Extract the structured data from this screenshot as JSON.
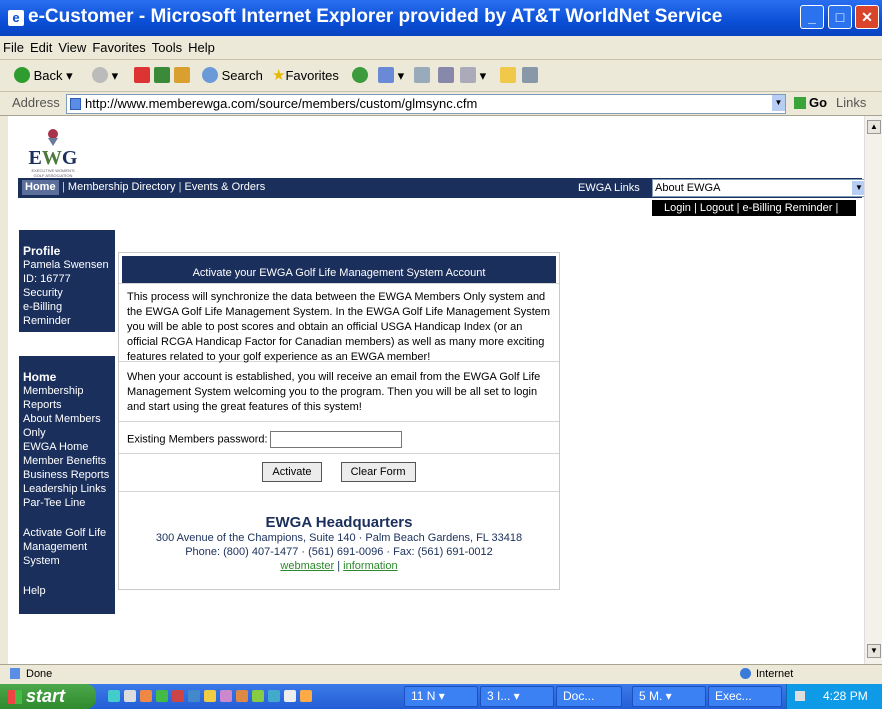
{
  "window": {
    "title": "e-Customer - Microsoft Internet Explorer provided by AT&T WorldNet Service"
  },
  "menu": [
    "File",
    "Edit",
    "View",
    "Favorites",
    "Tools",
    "Help"
  ],
  "toolbar": {
    "back": "Back",
    "search": "Search",
    "favorites": "Favorites"
  },
  "address": {
    "label": "Address",
    "url": "http://www.memberewga.com/source/members/custom/glmsync.cfm",
    "go": "Go",
    "links": "Links"
  },
  "site": {
    "logo_text": "EWG",
    "logo_sub": "EXECUTIVE WOMEN'S GOLF ASSOCIATION",
    "nav": {
      "home": "Home",
      "items": [
        "Membership Directory",
        "Events & Orders"
      ],
      "ewga_links_label": "EWGA Links",
      "ewga_links_value": "About EWGA"
    },
    "login_bar": [
      "Login",
      "Logout",
      "e-Billing Reminder"
    ],
    "profile": {
      "heading": "Profile",
      "items": [
        "Pamela Swensen",
        "ID: 16777",
        "Security",
        "e-Billing",
        "Reminder"
      ]
    },
    "menu": {
      "heading": "Home",
      "items": [
        "Membership",
        "Reports",
        "About Members",
        "Only",
        "EWGA Home",
        "Member Benefits",
        "Business Reports",
        "Leadership Links",
        "Par-Tee Line",
        "",
        "Activate Golf Life",
        "Management",
        "System",
        "",
        "Help"
      ]
    },
    "panel": {
      "title": "Activate your EWGA Golf Life Management System Account",
      "para1": "This process will synchronize the data between the EWGA Members Only system and the EWGA Golf Life Management System. In the EWGA Golf Life Management System you will be able to post scores and obtain an official USGA Handicap Index (or an official RCGA Handicap Factor for Canadian members) as well as many more exciting features related to your golf experience as an EWGA member!",
      "para2": "When your account is established, you will receive an email from the EWGA Golf Life Management System welcoming you to the program. Then you will be all set to login and start using the great features of this system!",
      "password_label": "Existing Members password:",
      "activate_button": "Activate",
      "clear_button": "Clear Form"
    },
    "hq": {
      "title": "EWGA Headquarters",
      "address": "300 Avenue of the Champions, Suite 140 · Palm Beach Gardens, FL 33418",
      "phone": "Phone: (800) 407-1477 · (561) 691-0096 · Fax: (561) 691-0012",
      "webmaster": "webmaster",
      "information": "information"
    }
  },
  "status": {
    "left": "Done",
    "zone": "Internet"
  },
  "taskbar": {
    "start": "start",
    "tasks": [
      "11 N ▾",
      "3 I... ▾",
      "Doc...",
      "5 M. ▾",
      "Exec..."
    ],
    "clock": "4:28 PM"
  }
}
